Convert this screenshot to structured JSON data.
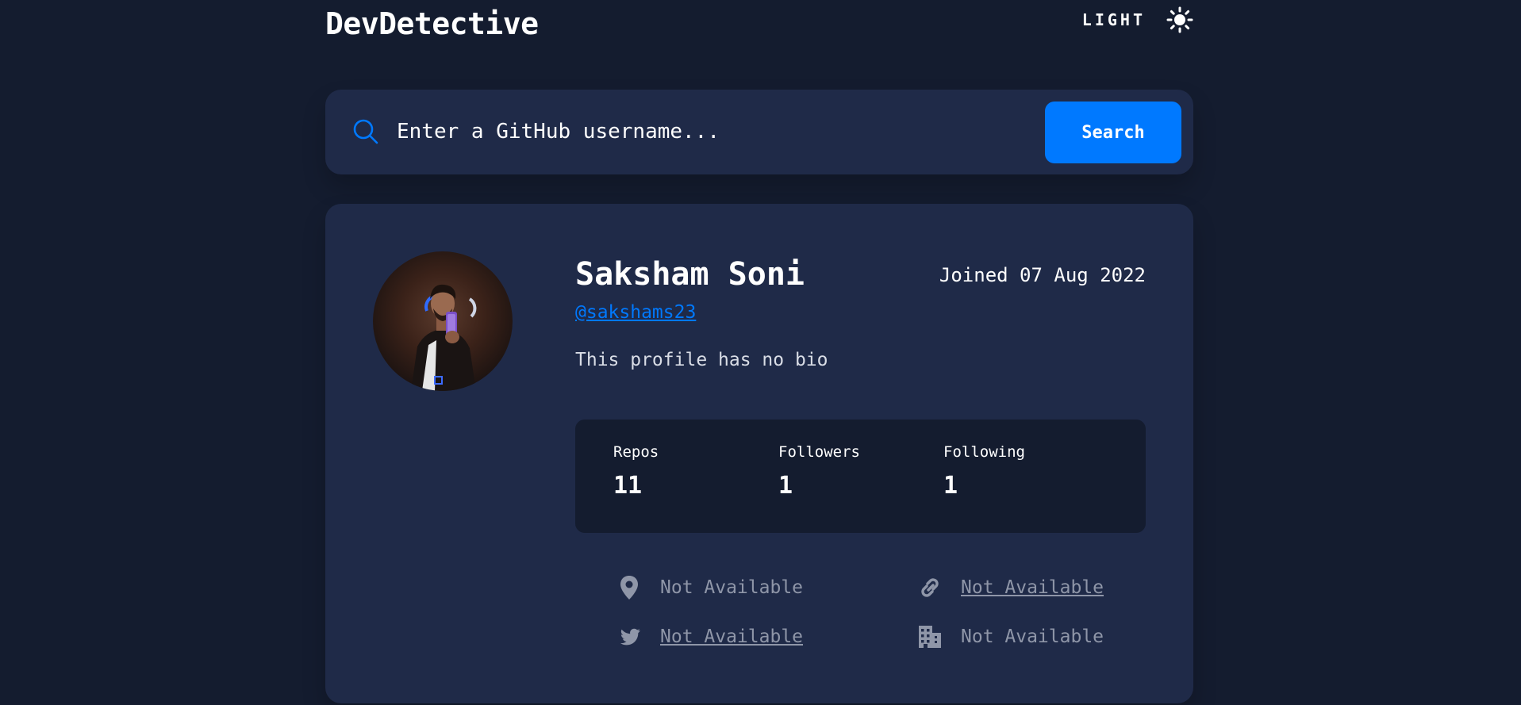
{
  "app": {
    "title": "DevDetective",
    "mode_label": "LIGHT",
    "mode_icon": "sun-icon"
  },
  "search": {
    "placeholder": "Enter a GitHub username...",
    "button_label": "Search",
    "icon": "search-icon"
  },
  "profile": {
    "name": "Saksham Soni",
    "login": "@sakshams23",
    "joined": "Joined 07 Aug 2022",
    "bio": "This profile has no bio",
    "stats": [
      {
        "label": "Repos",
        "value": "11"
      },
      {
        "label": "Followers",
        "value": "1"
      },
      {
        "label": "Following",
        "value": "1"
      }
    ],
    "links": {
      "location": {
        "text": "Not Available",
        "icon": "location-pin-icon"
      },
      "website": {
        "text": "Not Available",
        "icon": "link-icon"
      },
      "twitter": {
        "text": "Not Available",
        "icon": "twitter-icon"
      },
      "company": {
        "text": "Not Available",
        "icon": "building-icon"
      }
    }
  },
  "colors": {
    "background": "#141c2f",
    "card": "#1f2a48",
    "accent": "#0079ff",
    "muted": "#8f96a8"
  }
}
